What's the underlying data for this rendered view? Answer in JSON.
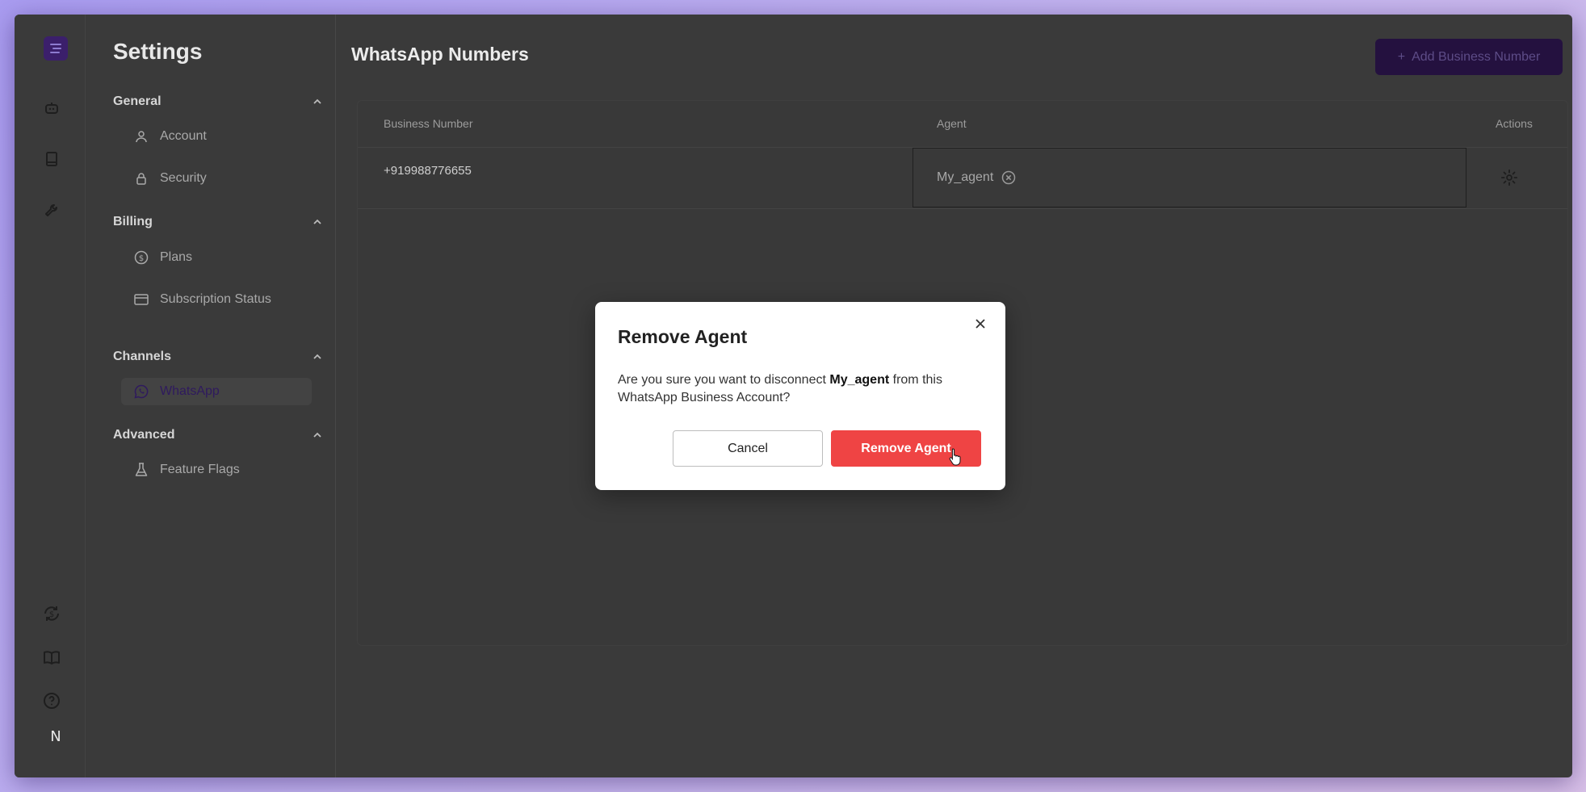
{
  "sidebar": {
    "title": "Settings",
    "groups": [
      {
        "label": "General",
        "items": [
          {
            "label": "Account",
            "icon": "user-icon"
          },
          {
            "label": "Security",
            "icon": "lock-icon"
          }
        ]
      },
      {
        "label": "Billing",
        "items": [
          {
            "label": "Plans",
            "icon": "dollar-icon"
          },
          {
            "label": "Subscription Status",
            "icon": "card-icon"
          }
        ]
      },
      {
        "label": "Channels",
        "items": [
          {
            "label": "WhatsApp",
            "icon": "whatsapp-icon",
            "active": true
          }
        ]
      },
      {
        "label": "Advanced",
        "items": [
          {
            "label": "Feature Flags",
            "icon": "flask-icon"
          }
        ]
      }
    ]
  },
  "rail": {
    "avatar_letter": "N"
  },
  "main": {
    "title": "WhatsApp Numbers",
    "add_button_label": "Add Business Number",
    "table": {
      "headers": [
        "Business Number",
        "Agent",
        "Actions"
      ],
      "rows": [
        {
          "number": "+919988776655",
          "agent": "My_agent"
        }
      ]
    }
  },
  "modal": {
    "title": "Remove Agent",
    "message_pre": "Are you sure you want to disconnect ",
    "message_agent": "My_agent",
    "message_post": " from this WhatsApp Business Account?",
    "cancel_label": "Cancel",
    "confirm_label": "Remove Agent"
  },
  "colors": {
    "accent": "#3b1f6b",
    "danger": "#ef4444",
    "surface_dark": "#3a3a3a"
  }
}
